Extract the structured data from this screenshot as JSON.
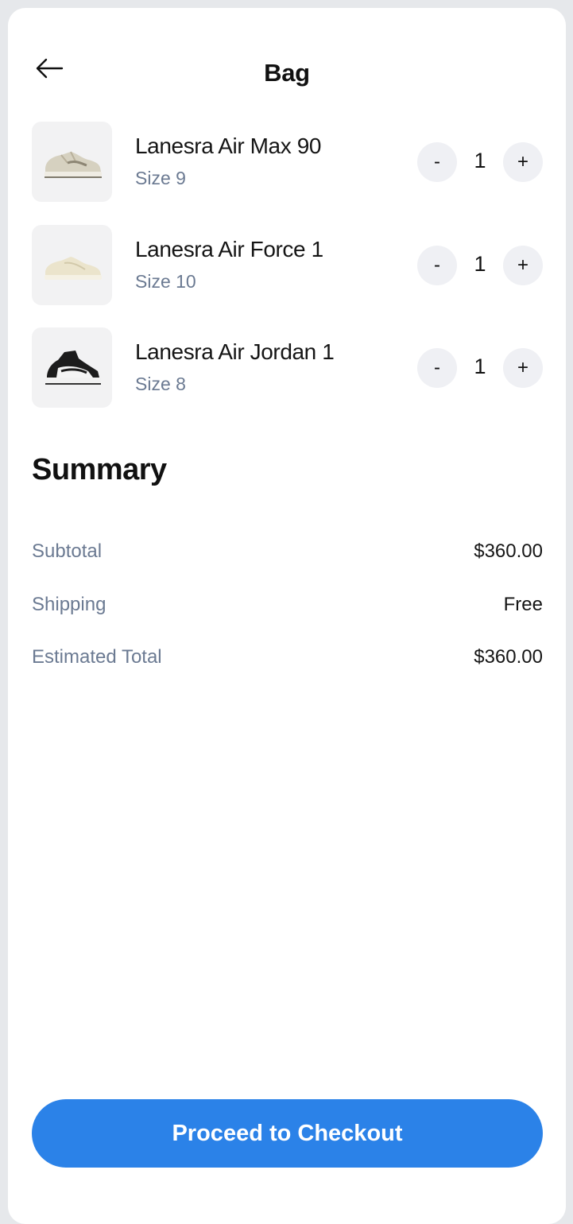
{
  "header": {
    "title": "Bag",
    "back_icon": "arrow-left-icon"
  },
  "cart": {
    "items": [
      {
        "name": "Lanesra Air Max 90",
        "size": "Size 9",
        "quantity": "1",
        "minus_label": "-",
        "plus_label": "+",
        "image": "sneaker-beige-icon"
      },
      {
        "name": "Lanesra Air Force 1",
        "size": "Size 10",
        "quantity": "1",
        "minus_label": "-",
        "plus_label": "+",
        "image": "sneaker-cream-icon"
      },
      {
        "name": "Lanesra Air Jordan 1",
        "size": "Size 8",
        "quantity": "1",
        "minus_label": "-",
        "plus_label": "+",
        "image": "sneaker-black-white-icon"
      }
    ]
  },
  "summary": {
    "title": "Summary",
    "rows": [
      {
        "label": "Subtotal",
        "value": "$360.00"
      },
      {
        "label": "Shipping",
        "value": "Free"
      },
      {
        "label": "Estimated Total",
        "value": "$360.00"
      }
    ]
  },
  "checkout": {
    "label": "Proceed to Checkout"
  },
  "colors": {
    "accent": "#2b82e8",
    "muted_text": "#6b7a92",
    "background": "#e6e8eb",
    "card": "#ffffff",
    "qty_button": "#eff0f4"
  }
}
